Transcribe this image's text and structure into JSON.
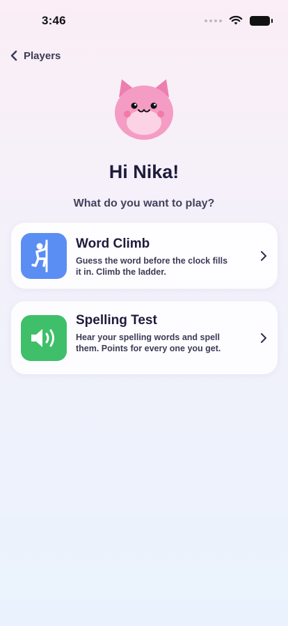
{
  "status_bar": {
    "time": "3:46"
  },
  "nav": {
    "back_label": "Players"
  },
  "header": {
    "greeting": "Hi Nika!",
    "prompt": "What do you want to play?"
  },
  "games": [
    {
      "title": "Word Climb",
      "description": "Guess the word before the clock fills it in. Climb the ladder.",
      "icon": "climber-icon",
      "color": "#5b8ef2"
    },
    {
      "title": "Spelling Test",
      "description": "Hear your spelling words and spell them. Points for every one you get.",
      "icon": "speaker-icon",
      "color": "#3fbf6a"
    }
  ],
  "colors": {
    "accent_pink": "#f59cc4",
    "text_primary": "#1e1b3a"
  }
}
